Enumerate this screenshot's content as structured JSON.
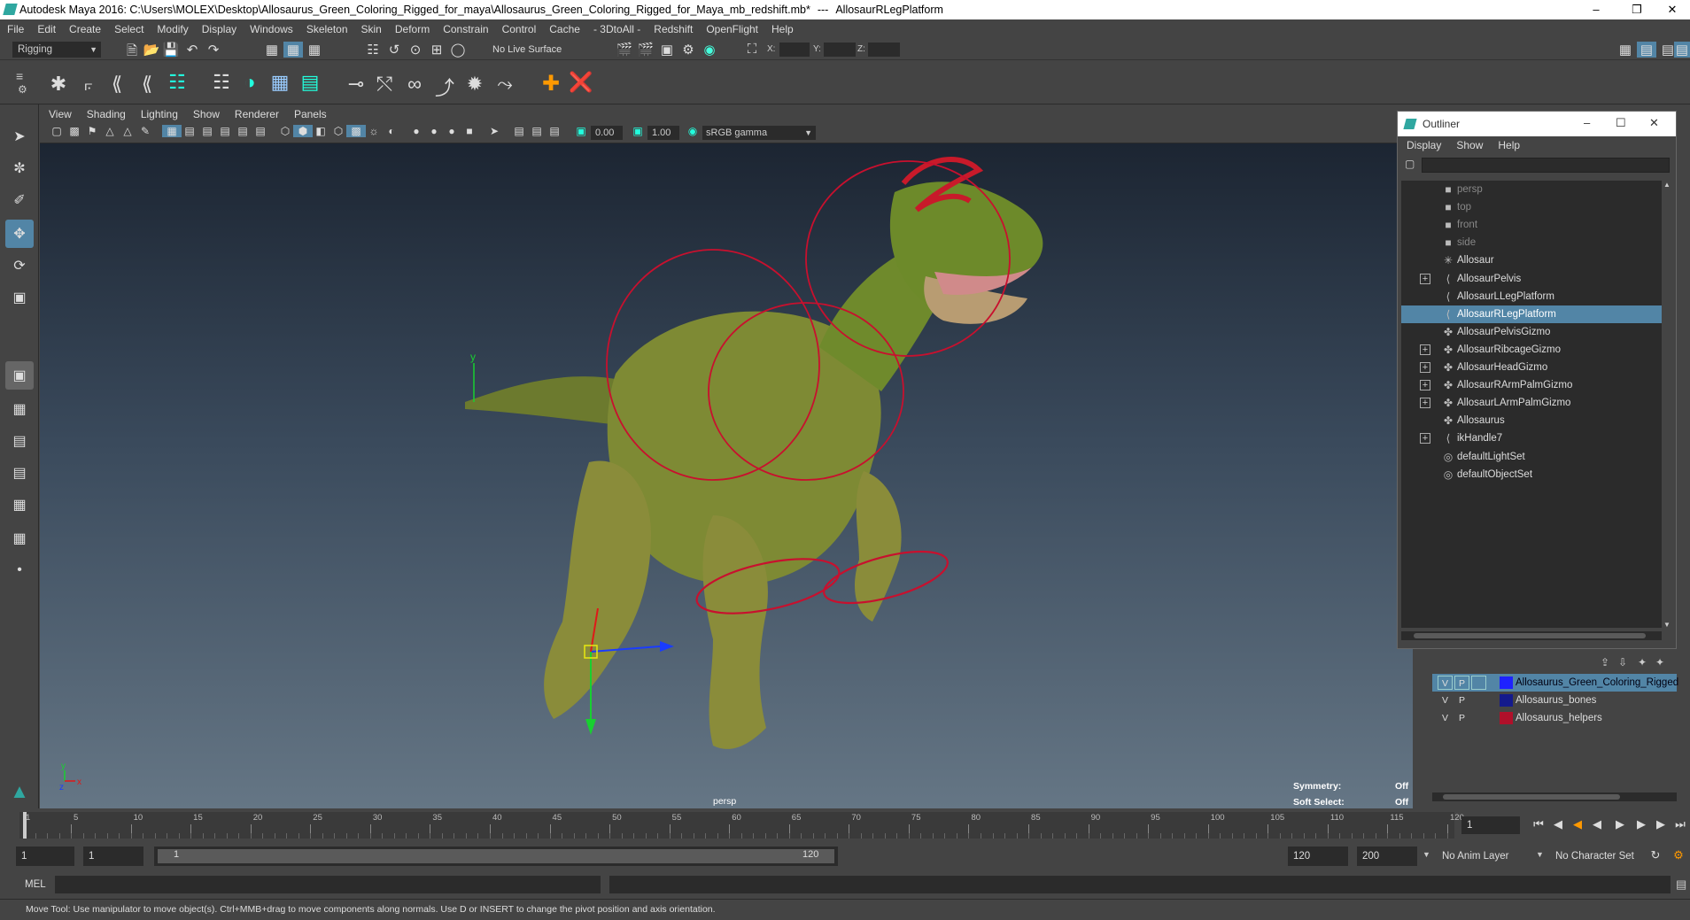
{
  "app": {
    "title": "Autodesk Maya 2016: C:\\Users\\MOLEX\\Desktop\\Allosaurus_Green_Coloring_Rigged_for_maya\\Allosaurus_Green_Coloring_Rigged_for_Maya_mb_redshift.mb*",
    "separator": "---",
    "selected_object": "AllosaurRLegPlatform"
  },
  "menus": [
    "File",
    "Edit",
    "Create",
    "Select",
    "Modify",
    "Display",
    "Windows",
    "Skeleton",
    "Skin",
    "Deform",
    "Constrain",
    "Control",
    "Cache",
    "- 3DtoAll -",
    "Redshift",
    "OpenFlight",
    "Help"
  ],
  "status_line": {
    "menuset": "Rigging",
    "live_surface": "No Live Surface",
    "x_label": "X:",
    "y_label": "Y:",
    "z_label": "Z:"
  },
  "viewport": {
    "menus": [
      "View",
      "Shading",
      "Lighting",
      "Show",
      "Renderer",
      "Panels"
    ],
    "exposure": "0.00",
    "gamma": "1.00",
    "color_space": "sRGB gamma",
    "camera_label": "persp",
    "hud": {
      "symmetry_label": "Symmetry:",
      "symmetry_value": "Off",
      "soft_select_label": "Soft Select:",
      "soft_select_value": "Off"
    },
    "axis_y": "y",
    "axis_x": "x",
    "axis_z": "z"
  },
  "outliner": {
    "title": "Outliner",
    "menus": [
      "Display",
      "Show",
      "Help"
    ],
    "items": [
      {
        "label": "persp",
        "icon": "camera-icon",
        "expandable": false,
        "dim": true,
        "selected": false
      },
      {
        "label": "top",
        "icon": "camera-icon",
        "expandable": false,
        "dim": true,
        "selected": false
      },
      {
        "label": "front",
        "icon": "camera-icon",
        "expandable": false,
        "dim": true,
        "selected": false
      },
      {
        "label": "side",
        "icon": "camera-icon",
        "expandable": false,
        "dim": true,
        "selected": false
      },
      {
        "label": "Allosaur",
        "icon": "locator-icon",
        "expandable": false,
        "dim": false,
        "selected": false
      },
      {
        "label": "AllosaurPelvis",
        "icon": "joint-icon",
        "expandable": true,
        "dim": false,
        "selected": false
      },
      {
        "label": "AllosaurLLegPlatform",
        "icon": "joint-icon",
        "expandable": false,
        "dim": false,
        "selected": false
      },
      {
        "label": "AllosaurRLegPlatform",
        "icon": "joint-icon",
        "expandable": false,
        "dim": false,
        "selected": true
      },
      {
        "label": "AllosaurPelvisGizmo",
        "icon": "curve-icon",
        "expandable": false,
        "dim": false,
        "selected": false
      },
      {
        "label": "AllosaurRibcageGizmo",
        "icon": "curve-icon",
        "expandable": true,
        "dim": false,
        "selected": false
      },
      {
        "label": "AllosaurHeadGizmo",
        "icon": "curve-icon",
        "expandable": true,
        "dim": false,
        "selected": false
      },
      {
        "label": "AllosaurRArmPalmGizmo",
        "icon": "curve-icon",
        "expandable": true,
        "dim": false,
        "selected": false
      },
      {
        "label": "AllosaurLArmPalmGizmo",
        "icon": "curve-icon",
        "expandable": true,
        "dim": false,
        "selected": false
      },
      {
        "label": "Allosaurus",
        "icon": "curve-icon",
        "expandable": false,
        "dim": false,
        "selected": false
      },
      {
        "label": "ikHandle7",
        "icon": "ik-icon",
        "expandable": true,
        "dim": false,
        "selected": false
      },
      {
        "label": "defaultLightSet",
        "icon": "set-icon",
        "expandable": false,
        "dim": false,
        "selected": false
      },
      {
        "label": "defaultObjectSet",
        "icon": "set-icon",
        "expandable": false,
        "dim": false,
        "selected": false
      }
    ]
  },
  "layers": [
    {
      "v": "V",
      "p": "P",
      "name": "Allosaurus_Green_Coloring_Rigged",
      "color": "#1e22ff",
      "selected": true
    },
    {
      "v": "V",
      "p": "P",
      "name": "Allosaurus_bones",
      "color": "#141a8c",
      "selected": false
    },
    {
      "v": "V",
      "p": "P",
      "name": "Allosaurus_helpers",
      "color": "#b0102a",
      "selected": false
    }
  ],
  "timeline": {
    "ticks": [
      "1",
      "5",
      "10",
      "15",
      "20",
      "25",
      "30",
      "35",
      "40",
      "45",
      "50",
      "55",
      "60",
      "65",
      "70",
      "75",
      "80",
      "85",
      "90",
      "95",
      "100",
      "105",
      "110",
      "115",
      "120"
    ],
    "current_frame": "1"
  },
  "range": {
    "start": "1",
    "playback_start": "1",
    "slider_start": "1",
    "slider_end": "120",
    "playback_end": "120",
    "end": "200",
    "anim_layer": "No Anim Layer",
    "character_set": "No Character Set"
  },
  "command_line": {
    "mode": "MEL"
  },
  "help_line": "Move Tool: Use manipulator to move object(s). Ctrl+MMB+drag to move components along normals. Use D or INSERT to change the pivot position and axis orientation.",
  "colors": {
    "selection": "#5285a6",
    "gizmo": "#c8102e",
    "ui_bg": "#444444"
  }
}
